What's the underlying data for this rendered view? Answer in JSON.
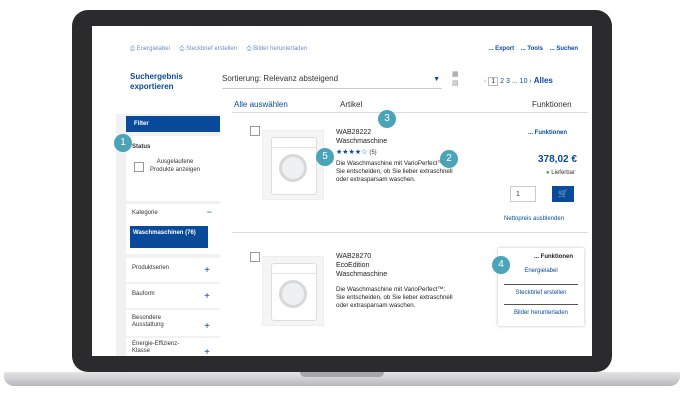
{
  "toolbar": {
    "links": [
      "Energielabel",
      "Steckbrief erstellen",
      "Bilder herunterladen"
    ],
    "right_links": [
      "... Export",
      "... Tools",
      "... Suchen"
    ]
  },
  "export_label": "Suchergebnis exportieren",
  "sort": {
    "label": "Sortierung: Relevanz absteigend"
  },
  "pager": {
    "pages": [
      "1",
      "2",
      "3",
      "...",
      "10"
    ],
    "all_label": "Alles"
  },
  "columns": {
    "select_all": "Alle auswählen",
    "article": "Artikel",
    "functions": "Funktionen"
  },
  "sidebar": {
    "filter_label": "Filter",
    "status_label": "Status",
    "status_option": "Ausgelaufene Produkte anzeigen",
    "category_label": "Kategorie",
    "category_chip": "Waschmaschinen (76)",
    "items": [
      {
        "label": "Produktserien"
      },
      {
        "label": "Bauform"
      },
      {
        "label": "Besondere Ausstattung"
      },
      {
        "label": "Energie-Effizienz-Klasse"
      }
    ]
  },
  "products": [
    {
      "model": "WAB28222",
      "name": "Waschmaschine",
      "rating_count": "(5)",
      "description": "Die Waschmaschine mit VarioPerfect™: Sie entscheiden, ob Sie lieber extraschnell oder extrasparsam waschen.",
      "functions_link": "... Funktionen",
      "price": "378,02 €",
      "delivery": "Lieferbar",
      "quantity": "1",
      "netto_link": "Nettopreis ausblenden"
    },
    {
      "model": "WAB28270",
      "name": "EcoEdition Waschmaschine",
      "description": "Die Waschmaschine mit VarioPerfect™: Sie entscheiden, ob Sie lieber extraschnell oder extrasparsam waschen."
    }
  ],
  "function_panel": {
    "title": "... Funktionen",
    "items": [
      "Energielabel",
      "Steckbrief erstellen",
      "Bilder herunterladen"
    ]
  },
  "callouts": [
    "1",
    "2",
    "3",
    "4",
    "5"
  ],
  "colors": {
    "accent": "#0a4a9a",
    "callout": "#3d9db3",
    "sidebar_bg": "#f1f1f1"
  }
}
